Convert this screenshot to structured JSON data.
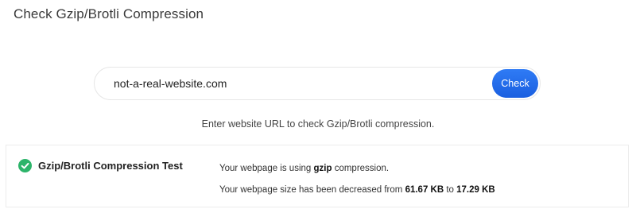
{
  "page": {
    "title": "Check Gzip/Brotli Compression"
  },
  "search": {
    "value": "not-a-real-website.com",
    "button_label": "Check"
  },
  "hint": "Enter website URL to check Gzip/Brotli compression.",
  "result": {
    "status_icon": "check-circle-icon",
    "status_color": "#2db46a",
    "button_color": "#1a5fe0",
    "test_name": "Gzip/Brotli Compression Test",
    "line1": {
      "prefix": "Your webpage is using ",
      "method": "gzip",
      "suffix": " compression."
    },
    "line2": {
      "prefix": "Your webpage size has been decreased from ",
      "original_size": "61.67 KB",
      "middle": " to ",
      "compressed_size": "17.29 KB"
    }
  }
}
